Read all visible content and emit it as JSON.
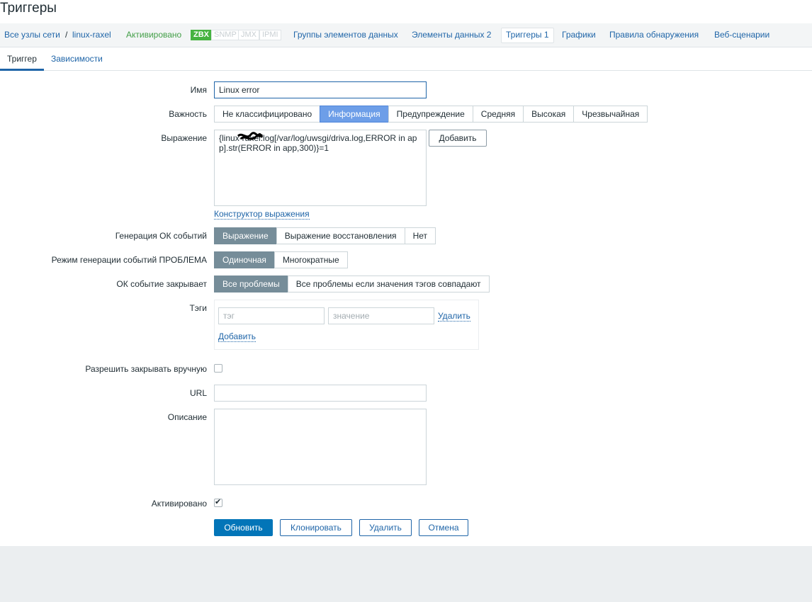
{
  "page": {
    "title": "Триггеры"
  },
  "nav": {
    "all_hosts": "Все узлы сети",
    "separator": "/",
    "host": "linux-raxel",
    "status": "Активировано",
    "badges": [
      "ZBX",
      "SNMP",
      "JMX",
      "IPMI"
    ],
    "app_groups": "Группы элементов данных",
    "items": "Элементы данных 2",
    "triggers": "Триггеры 1",
    "graphs": "Графики",
    "discovery": "Правила обнаружения",
    "web": "Веб-сценарии"
  },
  "tabs": {
    "trigger": "Триггер",
    "dependencies": "Зависимости"
  },
  "form": {
    "name_label": "Имя",
    "name_value": "Linux error",
    "severity_label": "Важность",
    "severities": [
      "Не классифицировано",
      "Информация",
      "Предупреждение",
      "Средняя",
      "Высокая",
      "Чрезвычайная"
    ],
    "expression_label": "Выражение",
    "expression_value": "{linux-raxel:log[/var/log/uwsgi/driva.log,ERROR in app].str(ERROR in app,300)}=1",
    "add_button": "Добавить",
    "constructor_link": "Конструктор выражения",
    "ok_gen_label": "Генерация ОК событий",
    "ok_gen_options": [
      "Выражение",
      "Выражение восстановления",
      "Нет"
    ],
    "problem_mode_label": "Режим генерации событий ПРОБЛЕМА",
    "problem_mode_options": [
      "Одиночная",
      "Многократные"
    ],
    "ok_closes_label": "ОК событие закрывает",
    "ok_closes_options": [
      "Все проблемы",
      "Все проблемы если значения тэгов совпадают"
    ],
    "tags_label": "Тэги",
    "tag_placeholder": "тэг",
    "value_placeholder": "значение",
    "tag_remove": "Удалить",
    "tag_add": "Добавить",
    "manual_close_label": "Разрешить закрывать вручную",
    "manual_close_checked": false,
    "url_label": "URL",
    "url_value": "",
    "description_label": "Описание",
    "description_value": "",
    "enabled_label": "Активировано",
    "enabled_checked": true
  },
  "buttons": {
    "update": "Обновить",
    "clone": "Клонировать",
    "delete": "Удалить",
    "cancel": "Отмена"
  },
  "colors": {
    "accent": "#1f65a8",
    "primary": "#0275b8",
    "selected_gray": "#768d99",
    "selected_blue": "#6d9ee8",
    "zbx": "#46b340",
    "status_green": "#429e47"
  }
}
